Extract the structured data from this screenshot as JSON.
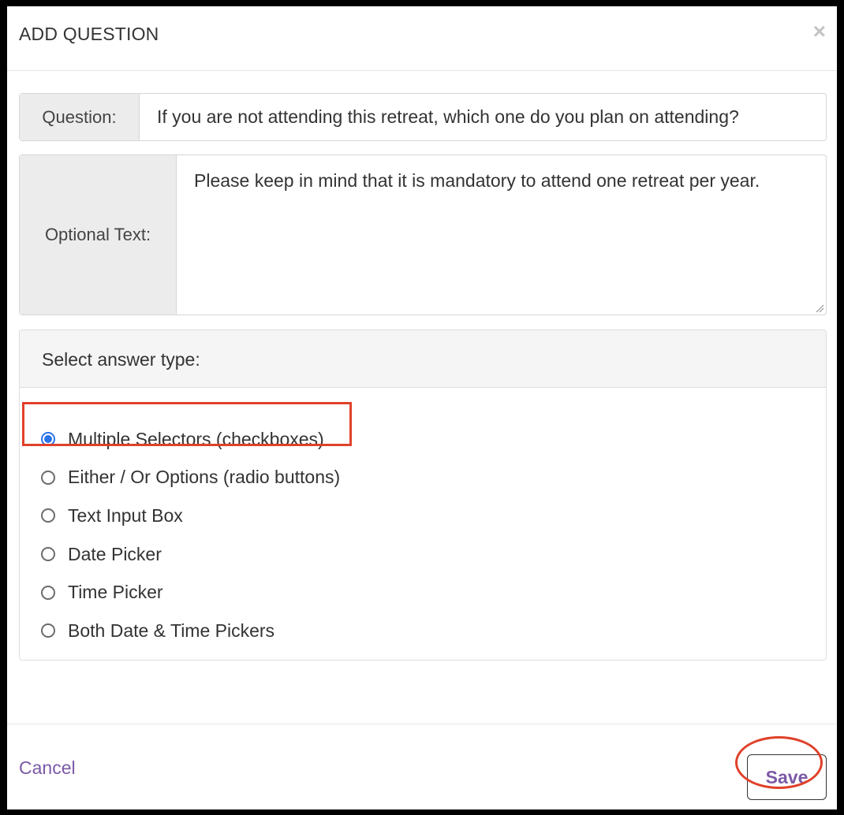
{
  "modal": {
    "title": "ADD QUESTION",
    "close_glyph": "×",
    "close_icon": "close-icon"
  },
  "question": {
    "label": "Question:",
    "value": "If you are not attending this retreat, which one do you plan on attending?"
  },
  "optional_text": {
    "label": "Optional Text:",
    "value": "Please keep in mind that it is mandatory to attend one retreat per year."
  },
  "answer_type": {
    "heading": "Select answer type:",
    "options": [
      {
        "label": "Multiple Selectors (checkboxes)",
        "checked": true
      },
      {
        "label": "Either / Or Options (radio buttons)",
        "checked": false
      },
      {
        "label": "Text Input Box",
        "checked": false
      },
      {
        "label": "Date Picker",
        "checked": false
      },
      {
        "label": "Time Picker",
        "checked": false
      },
      {
        "label": "Both Date & Time Pickers",
        "checked": false
      }
    ]
  },
  "footer": {
    "cancel_label": "Cancel",
    "save_label": "Save"
  },
  "colors": {
    "accent_purple": "#7b5aa6",
    "radio_selected": "#2a73e8",
    "annotation_red": "#e0412a"
  }
}
